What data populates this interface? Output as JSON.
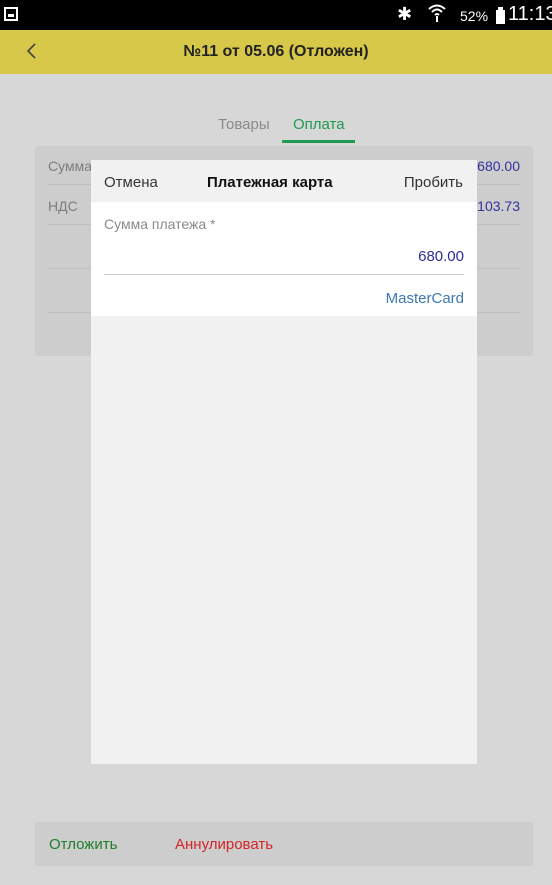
{
  "status_bar": {
    "battery_percent": "52%",
    "time": "11:13",
    "icons": [
      "screenshot-icon",
      "bluetooth-icon",
      "wifi-icon",
      "battery-icon"
    ]
  },
  "header": {
    "title": "№11 от 05.06 (Отложен)",
    "background_color": "#d8c84a"
  },
  "tabs": [
    {
      "label": "Товары",
      "active": false
    },
    {
      "label": "Оплата",
      "active": true
    }
  ],
  "background_rows": [
    {
      "label": "Сумма",
      "value": "680.00"
    },
    {
      "label": "НДС",
      "value": "103.73"
    },
    {
      "label": "",
      "value": ""
    },
    {
      "label": "",
      "value": ""
    }
  ],
  "modal": {
    "cancel_label": "Отмена",
    "title": "Платежная карта",
    "confirm_label": "Пробить",
    "amount_label": "Сумма платежа *",
    "amount_value": "680.00",
    "card_type": "MasterCard"
  },
  "footer": {
    "postpone_label": "Отложить",
    "annul_label": "Аннулировать"
  },
  "colors": {
    "accent_green": "#1f9a4e",
    "value_blue": "#2d2d9a",
    "danger_red": "#d22525"
  }
}
